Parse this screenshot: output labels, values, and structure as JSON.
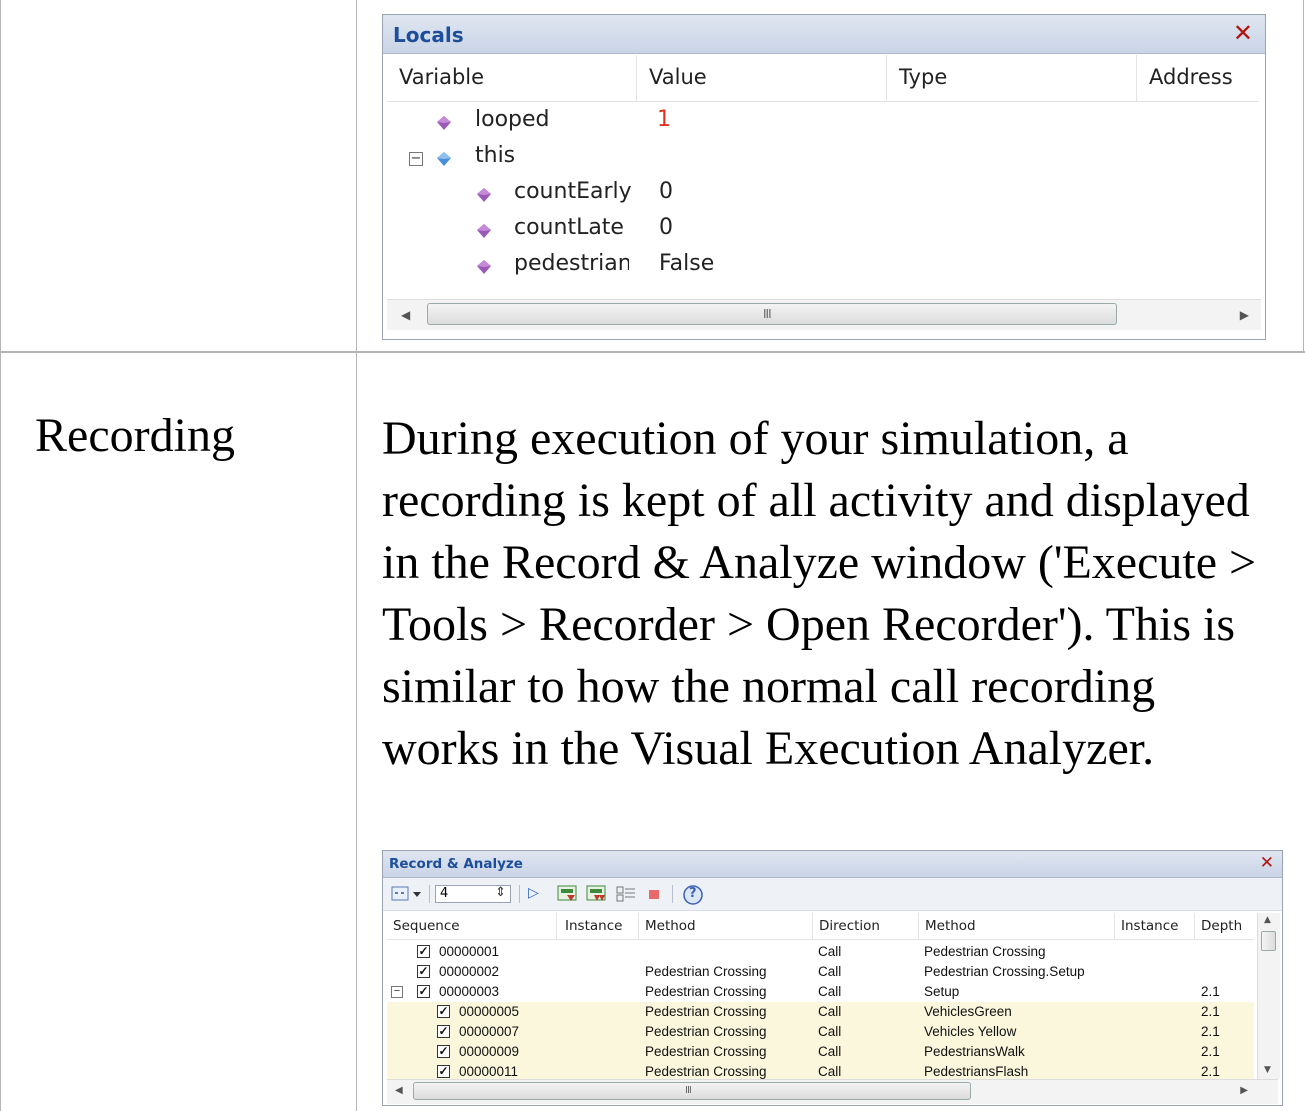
{
  "locals_window": {
    "title": "Locals",
    "close_glyph": "✕",
    "columns": [
      "Variable",
      "Value",
      "Type",
      "Address"
    ],
    "rows": [
      {
        "name": "looped",
        "value": "1"
      },
      {
        "name": "this",
        "value": ""
      },
      {
        "name": "countEarly",
        "value": "0"
      },
      {
        "name": "countLate",
        "value": "0"
      },
      {
        "name": "pedestrian",
        "value": "False"
      }
    ],
    "expander_glyph": "−",
    "scroll_left": "◀",
    "scroll_right": "▶",
    "scroll_grip": "III"
  },
  "doc": {
    "label": "Recording",
    "paragraph": "During execution of your simulation, a recording is kept of all activity and displayed in the Record & Analyze window ('Execute > Tools > Recorder > Open Recorder'). This is similar to how the normal call recording works in the Visual Execution Analyzer."
  },
  "record_window": {
    "title": "Record & Analyze",
    "close_glyph": "✕",
    "depth_value": "4",
    "columns": [
      "Sequence",
      "Instance",
      "Method",
      "Direction",
      "Method",
      "Instance",
      "Depth"
    ],
    "rows": [
      {
        "seq": "00000001",
        "instance": "",
        "method": "",
        "direction": "Call",
        "method2": "Pedestrian Crossing",
        "instance2": "",
        "depth": ""
      },
      {
        "seq": "00000002",
        "instance": "",
        "method": "Pedestrian Crossing",
        "direction": "Call",
        "method2": "Pedestrian Crossing.Setup",
        "instance2": "",
        "depth": ""
      },
      {
        "seq": "00000003",
        "instance": "",
        "method": "Pedestrian Crossing",
        "direction": "Call",
        "method2": "Setup",
        "instance2": "",
        "depth": "2.1"
      },
      {
        "seq": "00000005",
        "instance": "",
        "method": "Pedestrian Crossing",
        "direction": "Call",
        "method2": "VehiclesGreen",
        "instance2": "",
        "depth": "2.1"
      },
      {
        "seq": "00000007",
        "instance": "",
        "method": "Pedestrian Crossing",
        "direction": "Call",
        "method2": "Vehicles Yellow",
        "instance2": "",
        "depth": "2.1"
      },
      {
        "seq": "00000009",
        "instance": "",
        "method": "Pedestrian Crossing",
        "direction": "Call",
        "method2": "PedestriansWalk",
        "instance2": "",
        "depth": "2.1"
      },
      {
        "seq": "00000011",
        "instance": "",
        "method": "Pedestrian Crossing",
        "direction": "Call",
        "method2": "PedestriansFlash",
        "instance2": "",
        "depth": "2.1"
      }
    ],
    "check_glyph": "✓",
    "expander_glyph": "−",
    "spin_glyph": "⇕",
    "dropdown_glyph": "▾",
    "help_glyph": "?",
    "play_glyph": "▷",
    "scroll_grip": "III",
    "scroll_left": "◀",
    "scroll_right": "▶",
    "scroll_up": "▲",
    "scroll_down": "▼"
  },
  "colors": {
    "title_text": "#1c4e99",
    "close": "#b3140e",
    "value_highlight": "#e0301e",
    "row_highlight": "#fbf7dc",
    "field_gem": "#9b59b6",
    "object_gem": "#4a90d9"
  },
  "icons": [
    "close-icon",
    "field-icon",
    "object-icon",
    "expander-icon",
    "checkbox-icon",
    "play-icon",
    "record-icon",
    "step-icon",
    "stop-icon",
    "help-icon"
  ]
}
